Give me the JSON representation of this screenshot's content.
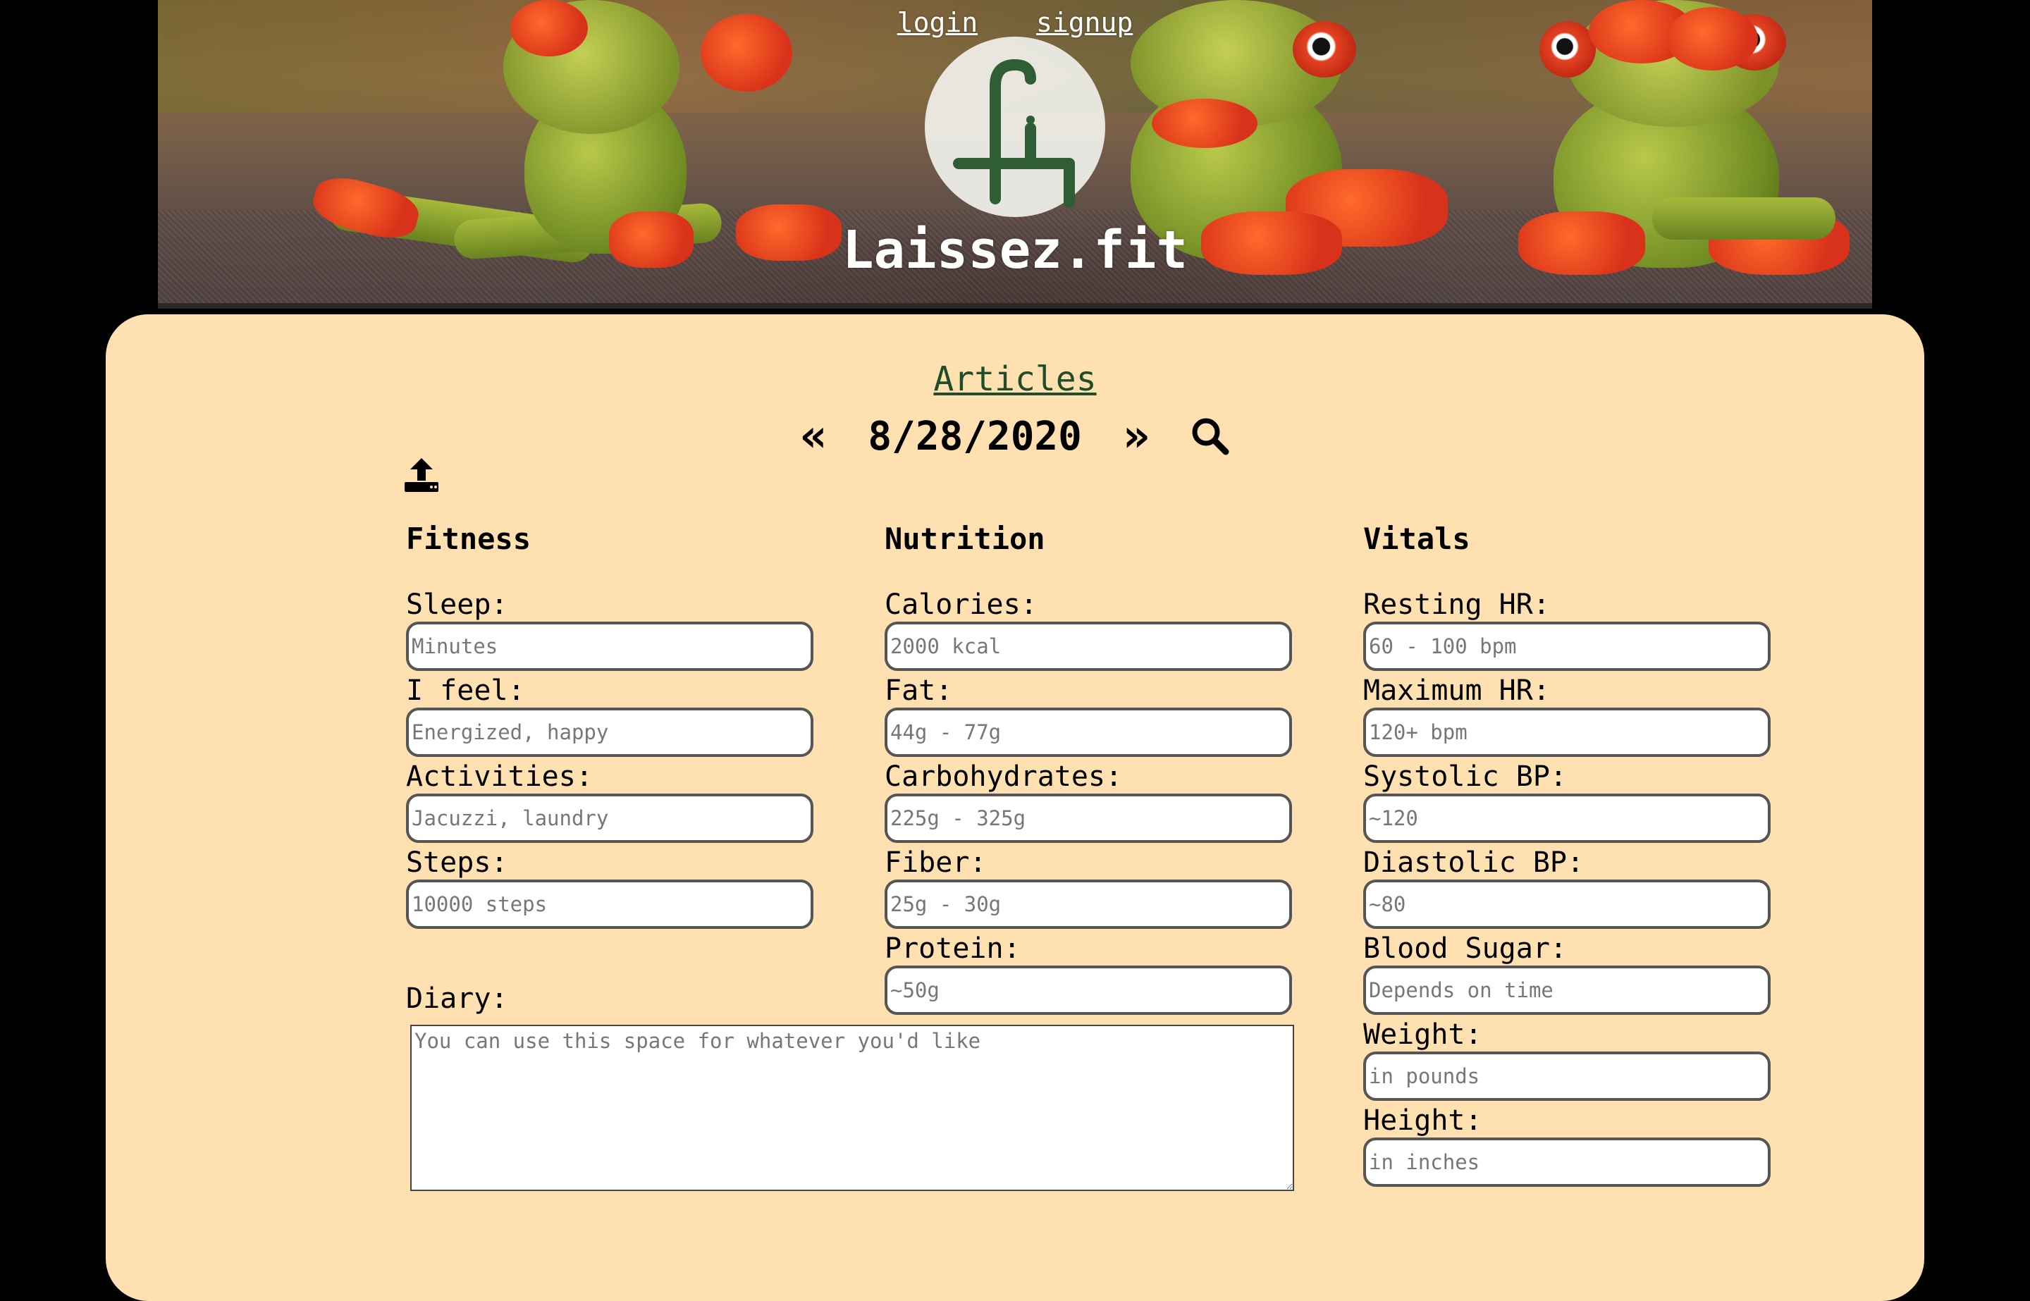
{
  "header": {
    "login_label": "login",
    "signup_label": "signup",
    "site_title": "Laissez.fit",
    "logo_icon": "lf-monogram-icon"
  },
  "nav": {
    "articles_label": "Articles"
  },
  "datebar": {
    "prev_label": "«",
    "date": "8/28/2020",
    "next_label": "»",
    "search_icon": "search-icon"
  },
  "upload_icon": "upload-icon",
  "fitness": {
    "heading": "Fitness",
    "fields": [
      {
        "label": "Sleep:",
        "placeholder": "Minutes"
      },
      {
        "label": "I feel:",
        "placeholder": "Energized, happy"
      },
      {
        "label": "Activities:",
        "placeholder": "Jacuzzi, laundry"
      },
      {
        "label": "Steps:",
        "placeholder": "10000 steps"
      }
    ]
  },
  "nutrition": {
    "heading": "Nutrition",
    "fields": [
      {
        "label": "Calories:",
        "placeholder": "2000 kcal"
      },
      {
        "label": "Fat:",
        "placeholder": "44g - 77g"
      },
      {
        "label": "Carbohydrates:",
        "placeholder": "225g - 325g"
      },
      {
        "label": "Fiber:",
        "placeholder": "25g - 30g"
      },
      {
        "label": "Protein:",
        "placeholder": "~50g"
      }
    ]
  },
  "vitals": {
    "heading": "Vitals",
    "fields": [
      {
        "label": "Resting HR:",
        "placeholder": "60 - 100 bpm"
      },
      {
        "label": "Maximum HR:",
        "placeholder": "120+ bpm"
      },
      {
        "label": "Systolic BP:",
        "placeholder": "~120"
      },
      {
        "label": "Diastolic BP:",
        "placeholder": "~80"
      },
      {
        "label": "Blood Sugar:",
        "placeholder": "Depends on time"
      },
      {
        "label": "Weight:",
        "placeholder": "in pounds"
      },
      {
        "label": "Height:",
        "placeholder": "in inches"
      }
    ]
  },
  "diary": {
    "label": "Diary:",
    "placeholder": "You can use this space for whatever you'd like"
  },
  "colors": {
    "panel_bg": "#ffe0b1",
    "page_bg": "#000000",
    "link_green": "#1f4d2a",
    "logo_green": "#2f5e35"
  }
}
